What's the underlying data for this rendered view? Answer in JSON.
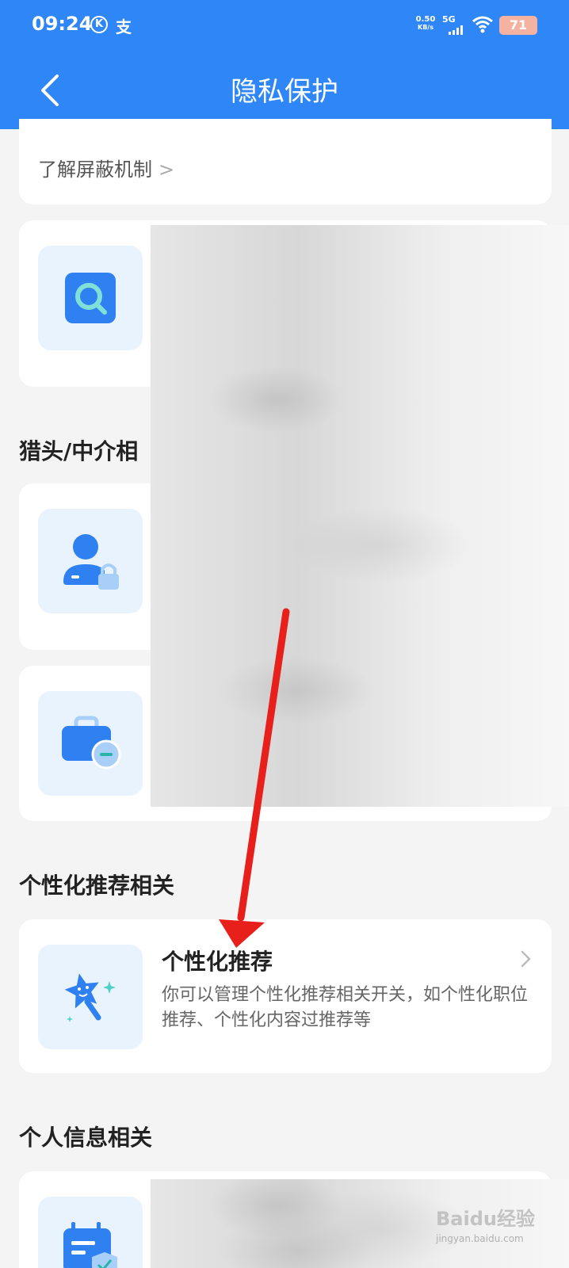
{
  "status_bar": {
    "time": "09:24",
    "k_icon": "K",
    "alipay_icon": "支",
    "net_speed_value": "0.50",
    "net_speed_unit": "KB/s",
    "signal_label": "5G",
    "battery": "71"
  },
  "header": {
    "title": "隐私保护",
    "bg_color": "#2f86f6"
  },
  "top_card": {
    "link_label": "了解屏蔽机制",
    "chevron": ">"
  },
  "sections": {
    "headhunter_label_partial": "猎头/中介相",
    "recommend_label": "个性化推荐相关",
    "personal_info_label": "个人信息相关"
  },
  "recommend_card": {
    "title": "个性化推荐",
    "description": "你可以管理个性化推荐相关开关，如个性化职位推荐、个性化内容过推荐等"
  },
  "icons": {
    "search": "search-icon",
    "user_lock": "user-lock-icon",
    "briefcase_minus": "briefcase-minus-icon",
    "star_wand": "star-wand-icon",
    "calendar_shield": "calendar-shield-icon"
  },
  "watermark": {
    "text": "Baidu经验",
    "sub": "jingyan.baidu.com"
  }
}
